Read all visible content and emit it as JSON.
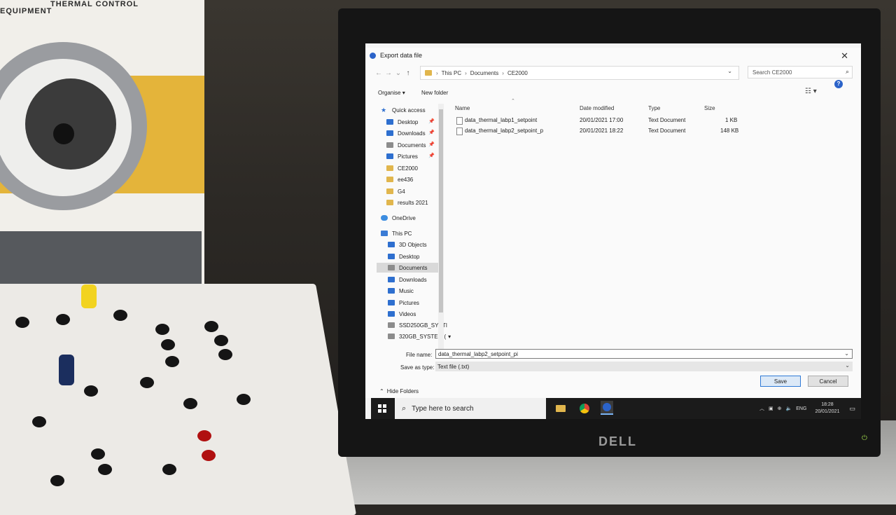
{
  "background": {
    "brand_left": "EQUIPMENT",
    "brand_right": "THERMAL CONTROL",
    "monitor_brand": "DELL"
  },
  "dialog": {
    "title": "Export data file",
    "breadcrumb": [
      "This PC",
      "Documents",
      "CE2000"
    ],
    "search_placeholder": "Search CE2000",
    "toolbar": {
      "organise": "Organise",
      "new_folder": "New folder",
      "help": "?"
    },
    "nav_pane": [
      {
        "label": "Quick access",
        "icon": "star-icon"
      },
      {
        "label": "Desktop",
        "icon": "desktop-icon",
        "pinned": true
      },
      {
        "label": "Downloads",
        "icon": "download-icon",
        "pinned": true
      },
      {
        "label": "Documents",
        "icon": "documents-icon",
        "pinned": true
      },
      {
        "label": "Pictures",
        "icon": "pictures-icon",
        "pinned": true
      },
      {
        "label": "CE2000",
        "icon": "folder-icon"
      },
      {
        "label": "ee436",
        "icon": "folder-icon"
      },
      {
        "label": "G4",
        "icon": "folder-icon"
      },
      {
        "label": "results 2021",
        "icon": "folder-icon"
      },
      {
        "label": "OneDrive",
        "icon": "cloud-icon"
      },
      {
        "label": "This PC",
        "icon": "computer-icon"
      },
      {
        "label": "3D Objects",
        "icon": "cube-icon"
      },
      {
        "label": "Desktop",
        "icon": "desktop-icon"
      },
      {
        "label": "Documents",
        "icon": "documents-icon",
        "selected": true
      },
      {
        "label": "Downloads",
        "icon": "download-icon"
      },
      {
        "label": "Music",
        "icon": "music-icon"
      },
      {
        "label": "Pictures",
        "icon": "pictures-icon"
      },
      {
        "label": "Videos",
        "icon": "video-icon"
      },
      {
        "label": "SSD250GB_SYSTI",
        "icon": "drive-icon"
      },
      {
        "label": "320GB_SYSTEM (",
        "icon": "drive-icon"
      }
    ],
    "columns": {
      "name": "Name",
      "date": "Date modified",
      "type": "Type",
      "size": "Size"
    },
    "files": [
      {
        "name": "data_thermal_labp1_setpoint",
        "date": "20/01/2021 17:00",
        "type": "Text Document",
        "size": "1 KB"
      },
      {
        "name": "data_thermal_labp2_setpoint_p",
        "date": "20/01/2021 18:22",
        "type": "Text Document",
        "size": "148 KB"
      }
    ],
    "file_name_label": "File name:",
    "file_name_value": "data_thermal_labp2_setpoint_pi",
    "save_as_type_label": "Save as type:",
    "save_as_type_value": "Text file (.txt)",
    "hide_folders": "Hide Folders",
    "save_button": "Save",
    "cancel_button": "Cancel"
  },
  "taskbar": {
    "search_placeholder": "Type here to search",
    "language": "ENG",
    "time": "18:28",
    "date": "20/01/2021"
  }
}
